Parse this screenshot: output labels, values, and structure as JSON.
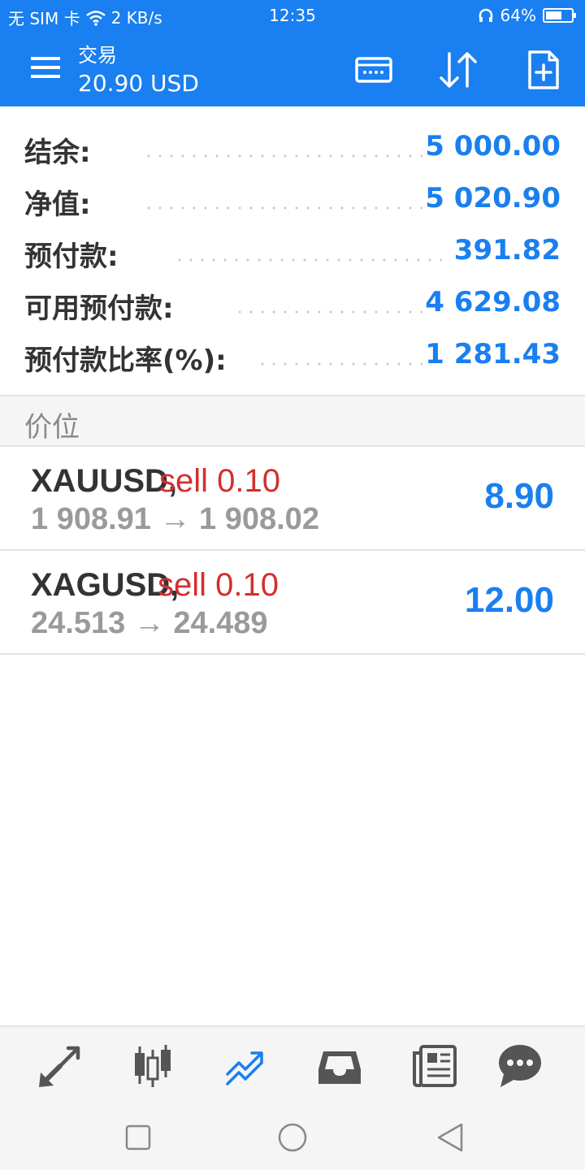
{
  "status_bar": {
    "carrier": "无 SIM 卡",
    "speed": "2 KB/s",
    "time": "12:35",
    "battery": "64%",
    "battery_level": 0.64
  },
  "app_bar": {
    "title": "交易",
    "subtitle": "20.90 USD",
    "icons": [
      "menu-icon",
      "deposit-card-icon",
      "sort-icon",
      "new-order-icon"
    ]
  },
  "summary": [
    {
      "label": "结余:",
      "value": "5 000.00"
    },
    {
      "label": "净值:",
      "value": "5 020.90"
    },
    {
      "label": "预付款:",
      "value": "391.82"
    },
    {
      "label": "可用预付款:",
      "value": "4 629.08"
    },
    {
      "label": "预付款比率(%):",
      "value": "1 281.43"
    }
  ],
  "positions_header": "价位",
  "positions": [
    {
      "symbol": "XAUUSD,",
      "side": "sell 0.10",
      "prices": "1 908.91 → 1 908.02",
      "profit": "8.90"
    },
    {
      "symbol": "XAGUSD,",
      "side": "sell 0.10",
      "prices": "24.513 → 24.489",
      "profit": "12.00"
    }
  ],
  "bottom_nav": [
    {
      "icon": "quotes-arrows-icon",
      "active": false
    },
    {
      "icon": "candlestick-chart-icon",
      "active": false
    },
    {
      "icon": "trade-icon",
      "active": true
    },
    {
      "icon": "history-inbox-icon",
      "active": false
    },
    {
      "icon": "news-icon",
      "active": false
    },
    {
      "icon": "chat-icon",
      "active": false
    }
  ],
  "colors": {
    "primary": "#1a7ff0",
    "sell": "#d32f2f",
    "text": "#333333",
    "muted": "#9a9a9a"
  }
}
